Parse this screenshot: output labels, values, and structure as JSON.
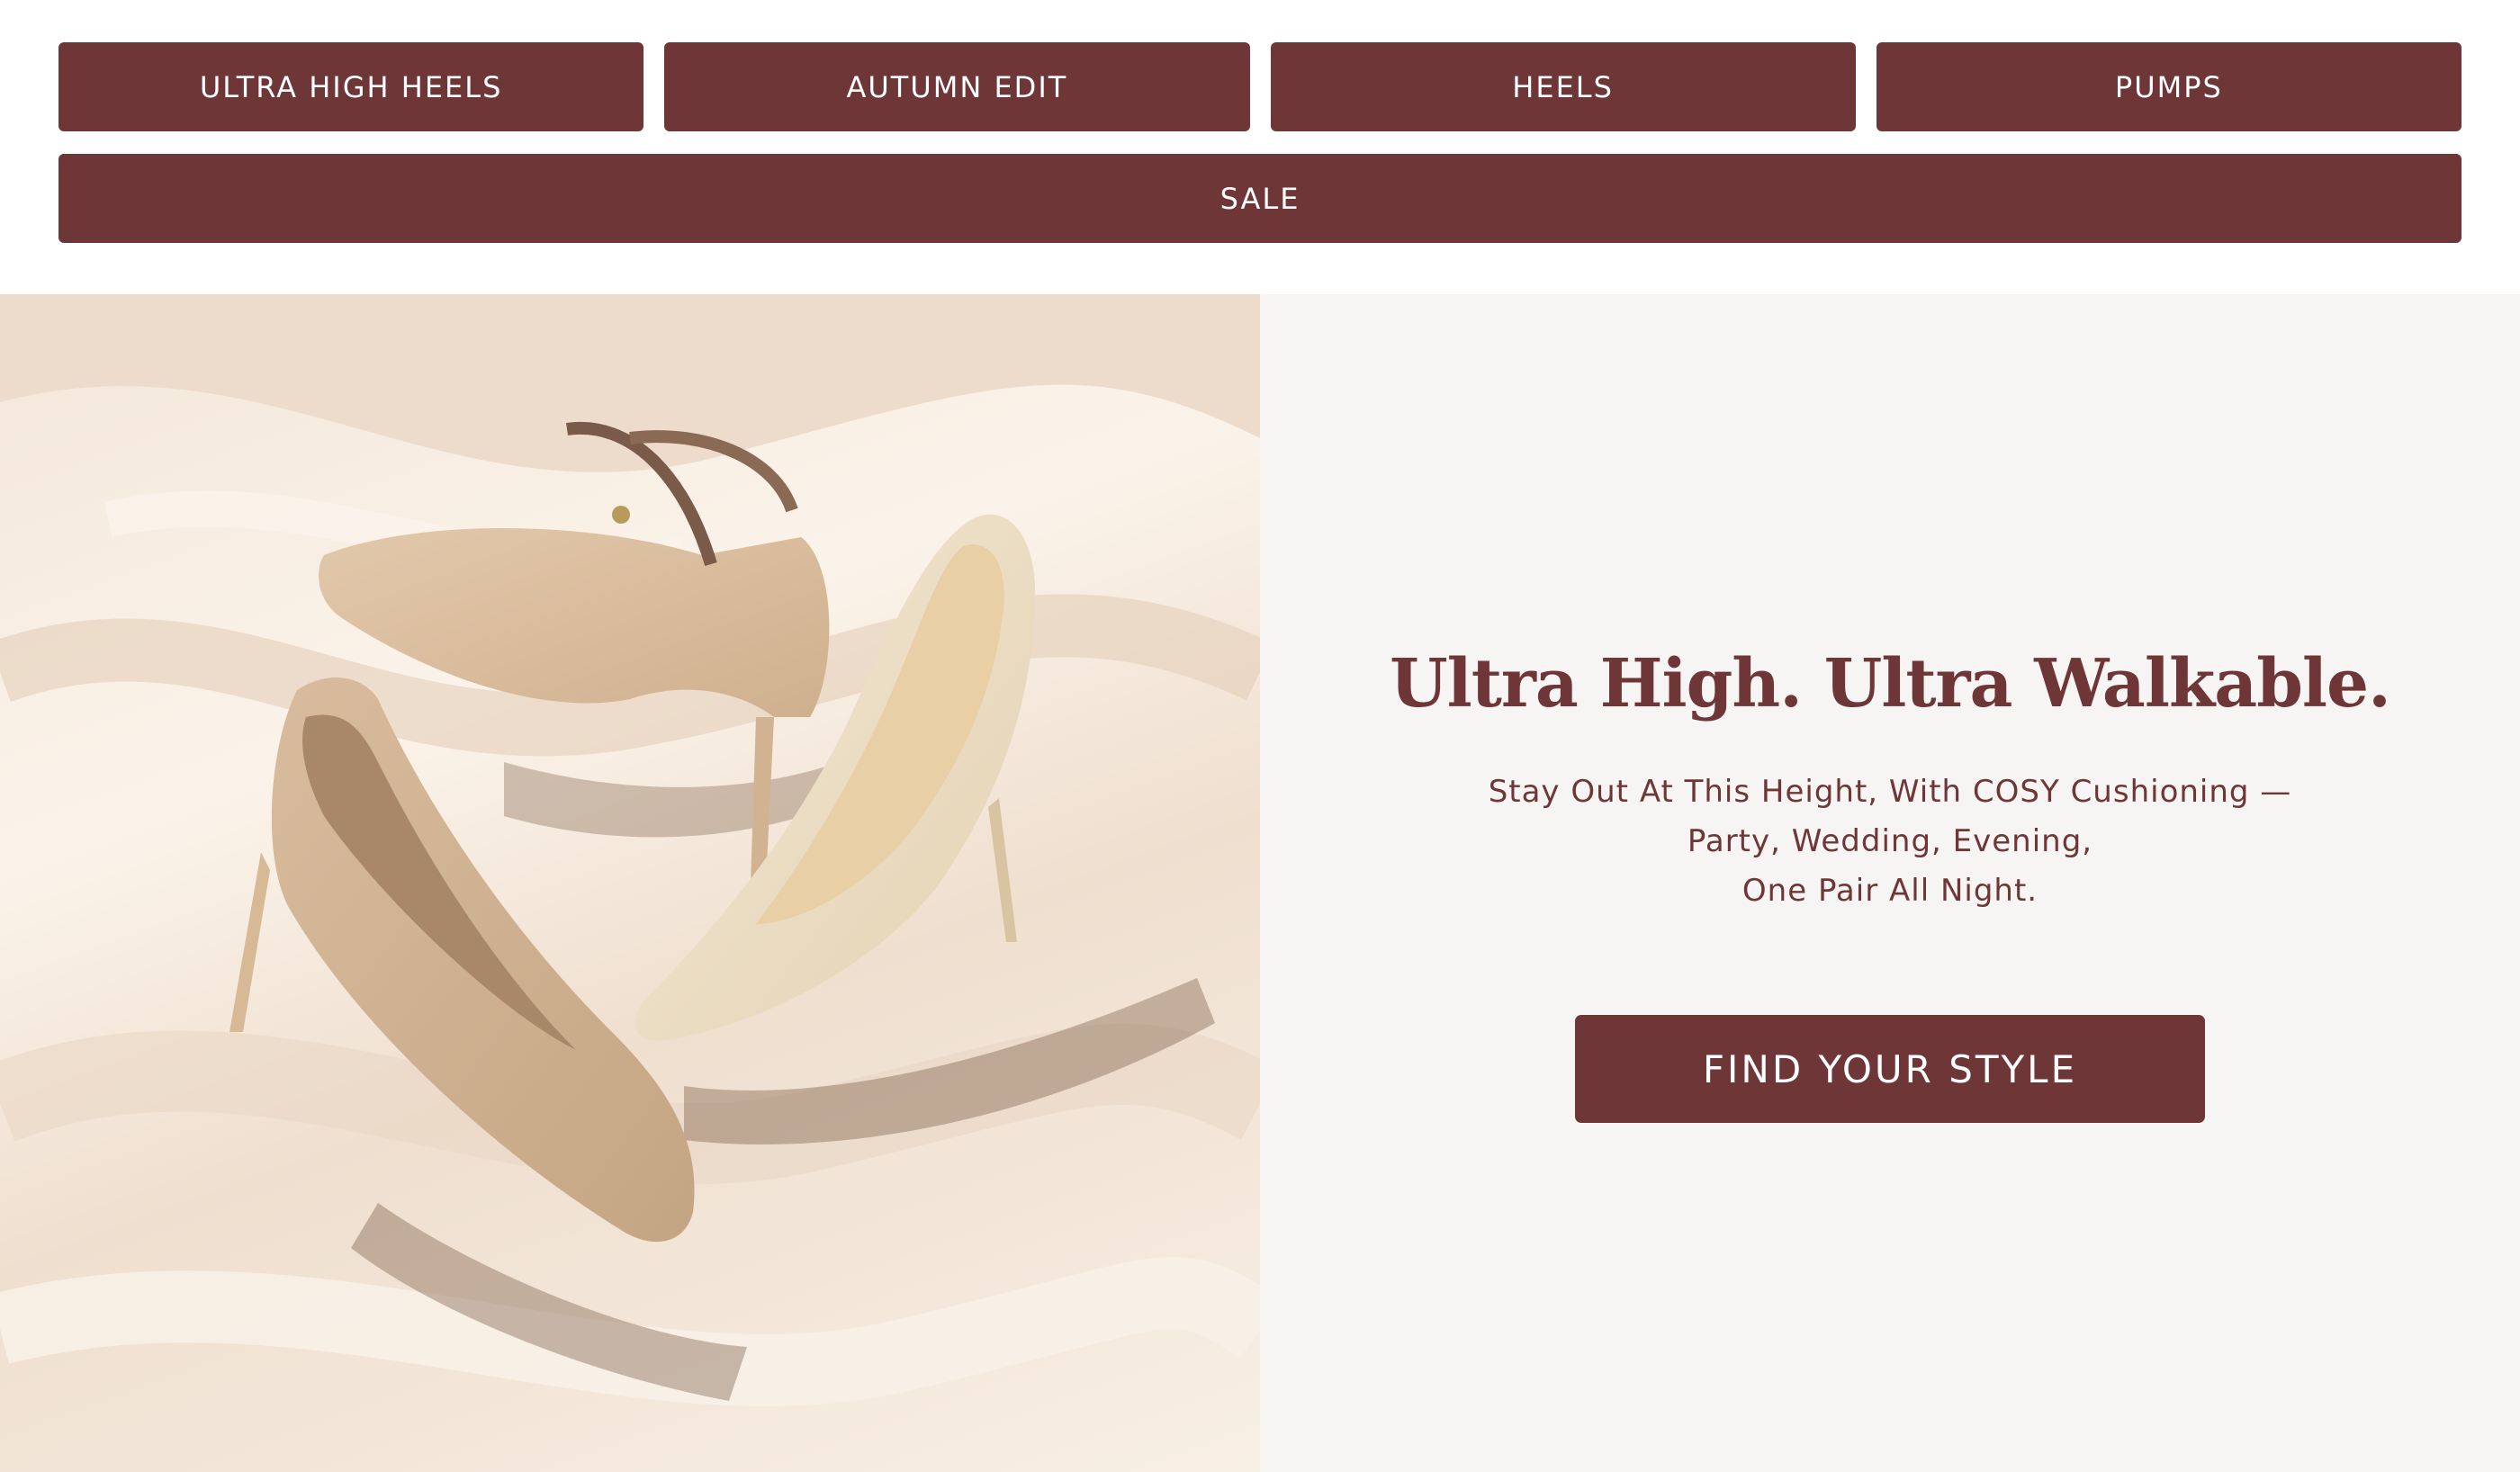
{
  "nav": {
    "row1": [
      {
        "label": "ULTRA HIGH HEELS"
      },
      {
        "label": "AUTUMN EDIT"
      },
      {
        "label": "HEELS"
      },
      {
        "label": "PUMPS"
      }
    ],
    "row2": [
      {
        "label": "SALE"
      }
    ]
  },
  "hero": {
    "headline": "Ultra High. Ultra Walkable.",
    "sub_line1": "Stay Out At This Height, With COSY Cushioning —",
    "sub_line2": "Party, Wedding, Evening,",
    "sub_line3": "One Pair All Night.",
    "cta_label": "FIND YOUR STYLE"
  },
  "colors": {
    "brand": "#6f3637",
    "panel_bg": "#f6f5f3",
    "button_text": "#ffffff"
  }
}
